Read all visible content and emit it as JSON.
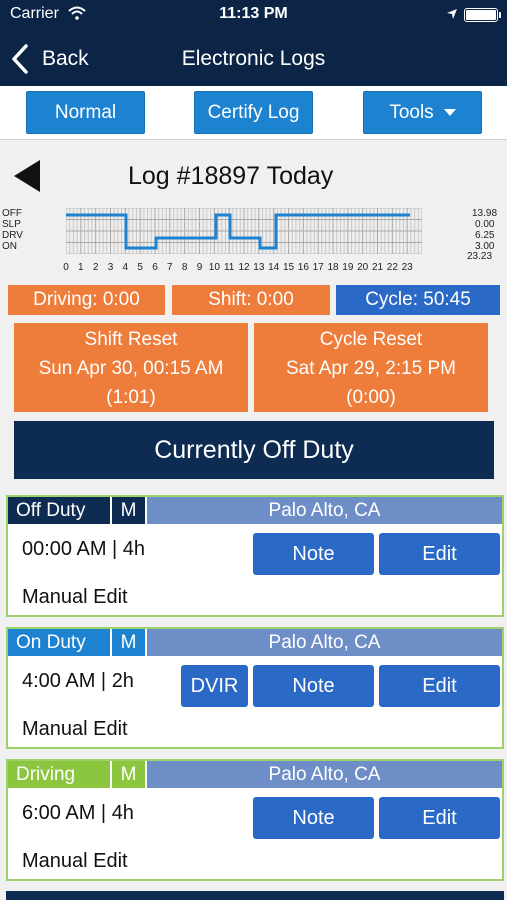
{
  "status_bar": {
    "carrier": "Carrier",
    "time": "11:13 PM"
  },
  "nav": {
    "back_label": "Back",
    "title": "Electronic Logs"
  },
  "toolbar": {
    "normal": "Normal",
    "certify": "Certify Log",
    "tools": "Tools"
  },
  "log": {
    "title": "Log #18897 Today"
  },
  "graph": {
    "row_labels": [
      "OFF",
      "SLP",
      "DRV",
      "ON"
    ],
    "totals": [
      "13.98",
      "0.00",
      "6.25",
      "3.00",
      "23.23"
    ],
    "hours": [
      "0",
      "1",
      "2",
      "3",
      "4",
      "5",
      "6",
      "7",
      "8",
      "9",
      "10",
      "11",
      "12",
      "13",
      "14",
      "15",
      "16",
      "17",
      "18",
      "19",
      "20",
      "21",
      "22",
      "23"
    ],
    "line_color": "#1d82d0"
  },
  "stats": {
    "driving": "Driving: 0:00",
    "shift": "Shift: 0:00",
    "cycle": "Cycle: 50:45"
  },
  "resets": {
    "shift": {
      "title": "Shift Reset",
      "date": "Sun Apr 30, 00:15 AM",
      "value": "(1:01)"
    },
    "cycle": {
      "title": "Cycle Reset",
      "date": "Sat Apr 29, 2:15 PM",
      "value": "(0:00)"
    }
  },
  "current_status": "Currently Off Duty",
  "entries": [
    {
      "type": "Off Duty",
      "mode": "M",
      "location": "Palo Alto,  CA",
      "time": "00:00 AM | 4h",
      "note": "Manual Edit",
      "note_button": "Note",
      "edit_button": "Edit",
      "color": "#0e2c52"
    },
    {
      "type": "On Duty",
      "mode": "M",
      "location": "Palo Alto,  CA",
      "time": "4:00 AM | 2h",
      "note": "Manual Edit",
      "dvir_button": "DVIR",
      "note_button": "Note",
      "edit_button": "Edit",
      "color": "#1d82d0"
    },
    {
      "type": "Driving",
      "mode": "M",
      "location": "Palo Alto,  CA",
      "time": "6:00 AM | 4h",
      "note": "Manual Edit",
      "note_button": "Note",
      "edit_button": "Edit",
      "color": "#8cc63f"
    }
  ],
  "colors": {
    "header": "#0c2547",
    "accent": "#1d82d0",
    "orange": "#ee7c3a",
    "cycle": "#2b69c6"
  }
}
